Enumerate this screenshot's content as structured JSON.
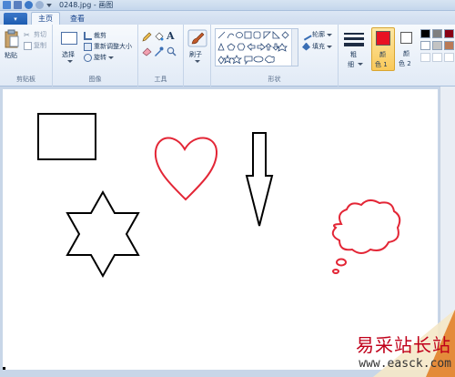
{
  "titlebar": {
    "title": "0248.jpg - 画图"
  },
  "tabs": {
    "file_label": "▾",
    "home": "主页",
    "view": "查看"
  },
  "clipboard": {
    "paste": "粘贴",
    "cut": "剪切",
    "copy": "复制",
    "group_label": "剪贴板"
  },
  "image": {
    "select": "选择",
    "crop": "裁剪",
    "resize": "重新调整大小",
    "rotate": "旋转",
    "group_label": "图像"
  },
  "tools": {
    "group_label": "工具"
  },
  "brushes": {
    "label": "刷子"
  },
  "shapes": {
    "outline": "轮廓",
    "fill": "填充",
    "group_label": "形状"
  },
  "size": {
    "label_line1": "粗",
    "label_line2": "细"
  },
  "colors": {
    "color1_line1": "颜",
    "color1_line2": "色 1",
    "color2_line1": "颜",
    "color2_line2": "色 2",
    "primary": "#e81123",
    "secondary": "#ffffff"
  },
  "palette": [
    "#000000",
    "#7f7f7f",
    "#880015",
    "#ffffff",
    "#c3c3c3",
    "#b97a57",
    "#ffffff",
    "#ffffff",
    "#ffffff"
  ],
  "drawing": {
    "shapes": [
      "rectangle",
      "heart",
      "down-arrow",
      "six-point-star",
      "thought-bubble"
    ],
    "heart_color": "#e32636",
    "cloud_color": "#e32636",
    "stroke_color": "#000000"
  },
  "watermark": {
    "brand": "易采站长站",
    "url": "www.easck.com"
  }
}
